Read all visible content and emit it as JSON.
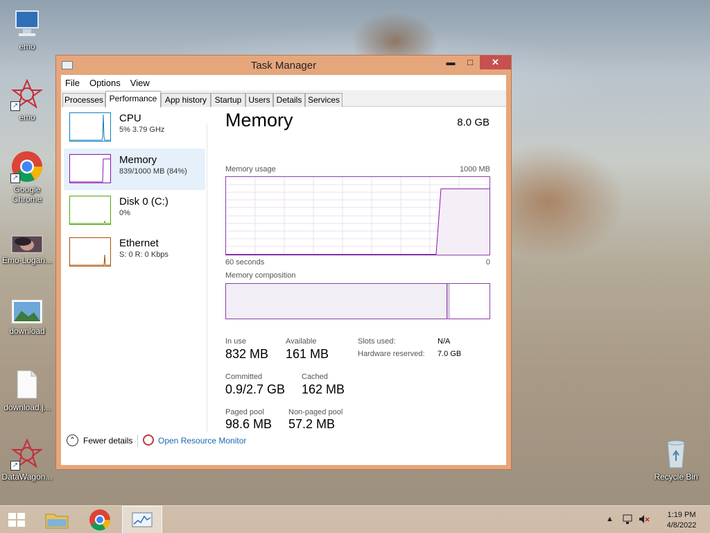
{
  "desktop": {
    "icons": [
      {
        "label": "emo",
        "icon": "computer-icon"
      },
      {
        "label": "emo",
        "icon": "red-star-shortcut-icon"
      },
      {
        "label": "Google Chrome",
        "icon": "chrome-icon"
      },
      {
        "label": "Emo-Logan...",
        "icon": "photo-icon"
      },
      {
        "label": "download",
        "icon": "image-file-icon"
      },
      {
        "label": "download.j...",
        "icon": "file-icon"
      },
      {
        "label": "DataWagon...",
        "icon": "red-star-shortcut-icon"
      },
      {
        "label": "Recycle Bin",
        "icon": "recycle-bin-icon"
      }
    ]
  },
  "window": {
    "title": "Task Manager",
    "min_glyph": "▬",
    "max_glyph": "□",
    "close_glyph": "✕"
  },
  "menu": [
    "File",
    "Options",
    "View"
  ],
  "tabs": [
    "Processes",
    "Performance",
    "App history",
    "Startup",
    "Users",
    "Details",
    "Services"
  ],
  "active_tab": "Performance",
  "perf_list": [
    {
      "name": "CPU",
      "sub": "5% 3.79 GHz",
      "color": "#117dbb"
    },
    {
      "name": "Memory",
      "sub": "839/1000 MB (84%)",
      "color": "#8b12ae"
    },
    {
      "name": "Disk 0 (C:)",
      "sub": "0%",
      "color": "#4da60c"
    },
    {
      "name": "Ethernet",
      "sub": "S: 0 R: 0 Kbps",
      "color": "#a74f01"
    }
  ],
  "memory": {
    "title": "Memory",
    "total": "8.0 GB",
    "usage_label": "Memory usage",
    "usage_max": "1000 MB",
    "time_left": "60 seconds",
    "time_right": "0",
    "composition_label": "Memory composition",
    "in_use_fraction": 0.84,
    "stats": {
      "in_use_label": "In use",
      "in_use": "832 MB",
      "available_label": "Available",
      "available": "161 MB",
      "committed_label": "Committed",
      "committed": "0.9/2.7 GB",
      "cached_label": "Cached",
      "cached": "162 MB",
      "paged_label": "Paged pool",
      "paged": "98.6 MB",
      "nonpaged_label": "Non-paged pool",
      "nonpaged": "57.2 MB",
      "slots_label": "Slots used:",
      "slots": "N/A",
      "hw_label": "Hardware reserved:",
      "hw": "7.0 GB"
    }
  },
  "footer": {
    "fewer": "Fewer details",
    "resource_monitor": "Open Resource Monitor"
  },
  "taskbar": {
    "time": "1:19 PM",
    "date": "4/8/2022"
  },
  "colors": {
    "accent": "#8b3fa7",
    "link": "#1e66b5",
    "window_frame": "#e6a67c",
    "close": "#c75050"
  }
}
